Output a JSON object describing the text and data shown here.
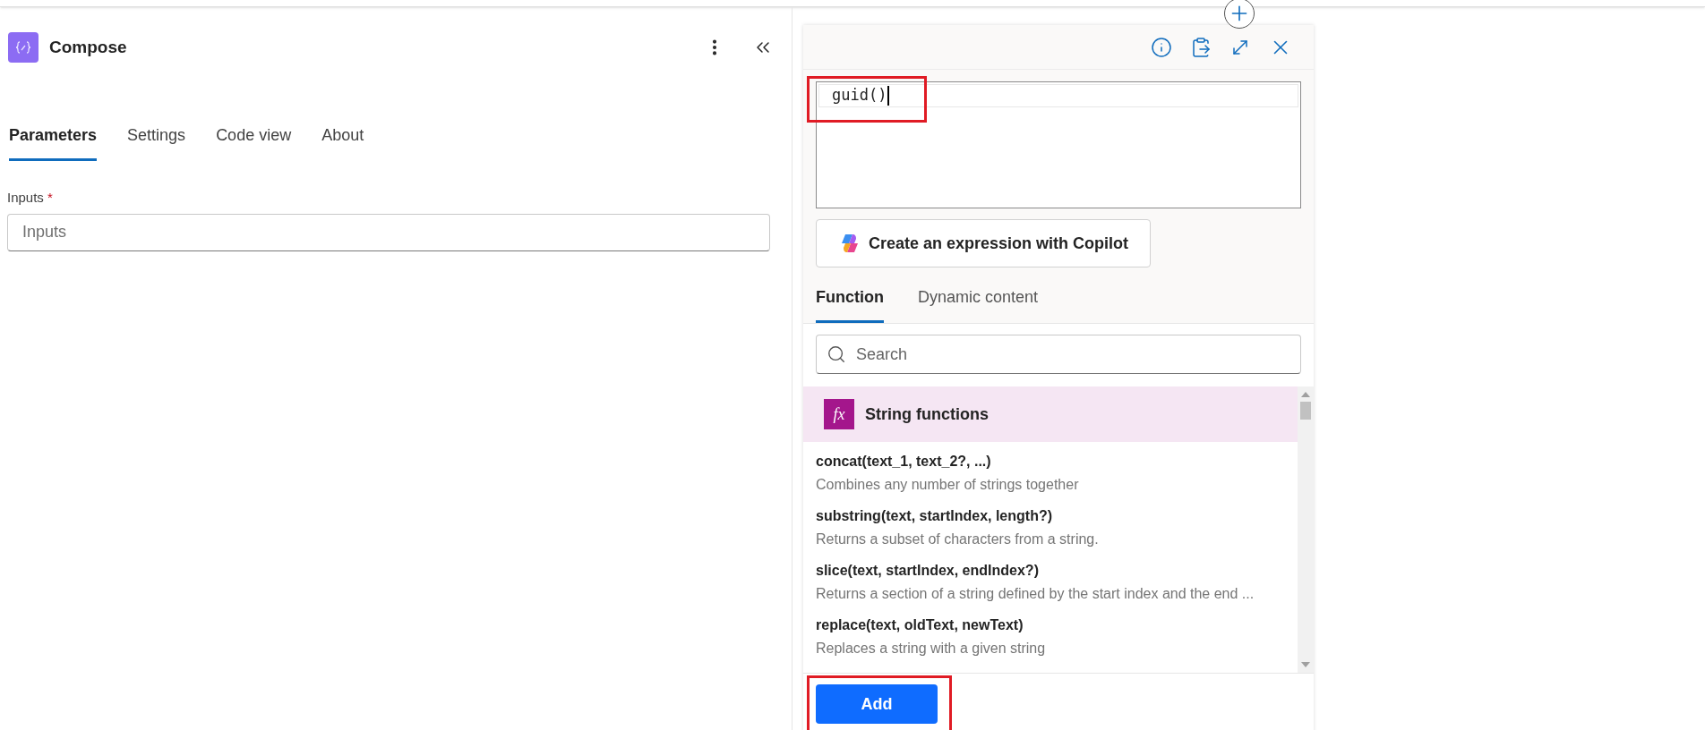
{
  "header": {
    "title": "Compose"
  },
  "tabs": [
    {
      "label": "Parameters",
      "selected": true
    },
    {
      "label": "Settings",
      "selected": false
    },
    {
      "label": "Code view",
      "selected": false
    },
    {
      "label": "About",
      "selected": false
    }
  ],
  "inputs": {
    "label": "Inputs",
    "required_mark": "*",
    "placeholder": "Inputs"
  },
  "expression_editor": {
    "value": "guid()",
    "copilot_button": "Create an expression with Copilot",
    "tabs": [
      {
        "label": "Function",
        "selected": true
      },
      {
        "label": "Dynamic content",
        "selected": false
      }
    ],
    "search": {
      "placeholder": "Search"
    },
    "category": {
      "icon": "fx",
      "title": "String functions"
    },
    "functions": [
      {
        "signature": "concat(text_1, text_2?, ...)",
        "description": "Combines any number of strings together"
      },
      {
        "signature": "substring(text, startIndex, length?)",
        "description": "Returns a subset of characters from a string."
      },
      {
        "signature": "slice(text, startIndex, endIndex?)",
        "description": "Returns a section of a string defined by the start index and the end ..."
      },
      {
        "signature": "replace(text, oldText, newText)",
        "description": "Replaces a string with a given string"
      }
    ],
    "add_button": "Add"
  }
}
